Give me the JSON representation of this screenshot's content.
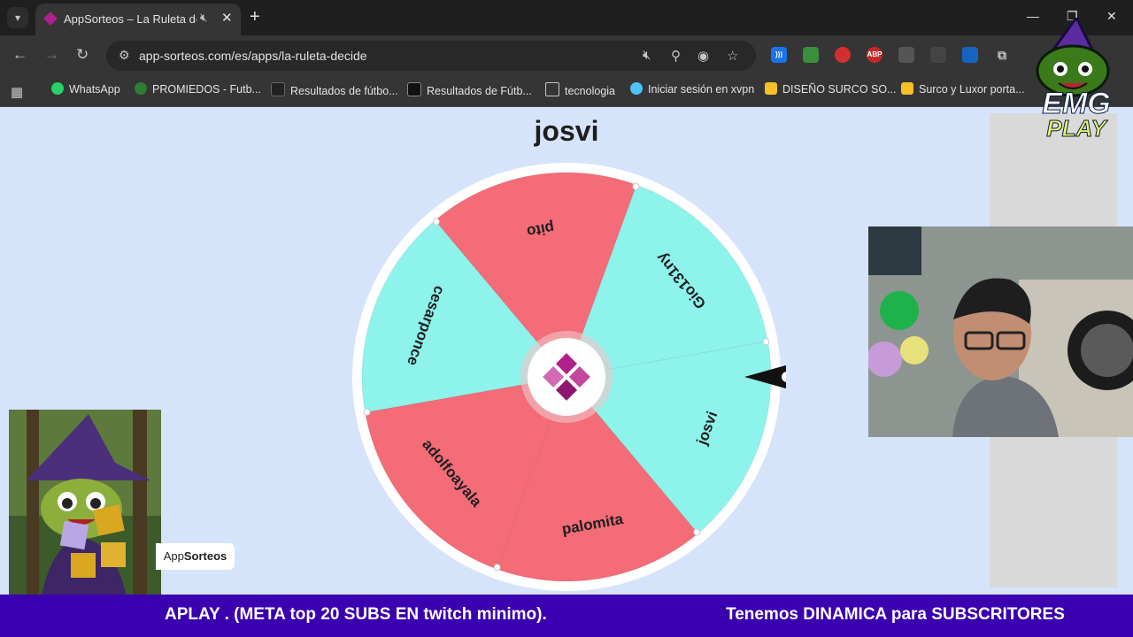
{
  "browser": {
    "tab_title": "AppSorteos – La Ruleta de l",
    "url": "app-sorteos.com/es/apps/la-ruleta-decide",
    "bookmarks": [
      {
        "label": "WhatsApp"
      },
      {
        "label": "PROMIEDOS - Futb..."
      },
      {
        "label": "Resultados de fútbo..."
      },
      {
        "label": "Resultados de Fútb..."
      },
      {
        "label": "tecnologia"
      },
      {
        "label": "Iniciar sesión en xvpn"
      },
      {
        "label": "DISEÑO SURCO SO..."
      },
      {
        "label": "Surco y Luxor porta..."
      }
    ],
    "ext_abp": "ABP"
  },
  "page": {
    "winner_title": "josvi",
    "wheel": {
      "slices": [
        {
          "label": "Gio131ny",
          "color": "#8ef3eb"
        },
        {
          "label": "josvi",
          "color": "#8ef3eb"
        },
        {
          "label": "palomita",
          "color": "#f36c78"
        },
        {
          "label": "adolfoayala",
          "color": "#f36c78"
        },
        {
          "label": "cesarponce",
          "color": "#8ef3eb"
        },
        {
          "label": "pito",
          "color": "#f36c78"
        }
      ]
    },
    "brand_app": "App",
    "brand_sorteos": "Sorteos"
  },
  "overlay": {
    "logo_line1": "EMG",
    "logo_line2": "PLAY",
    "ticker_left": "APLAY .  (META  top 20 SUBS  EN  twitch minimo).",
    "ticker_right": "Tenemos DINAMICA para SUBSCRITORES"
  },
  "colors": {
    "page_bg": "#d6e4fb",
    "ticker_bg": "#3a00b0",
    "brand": "#b11f8c"
  }
}
